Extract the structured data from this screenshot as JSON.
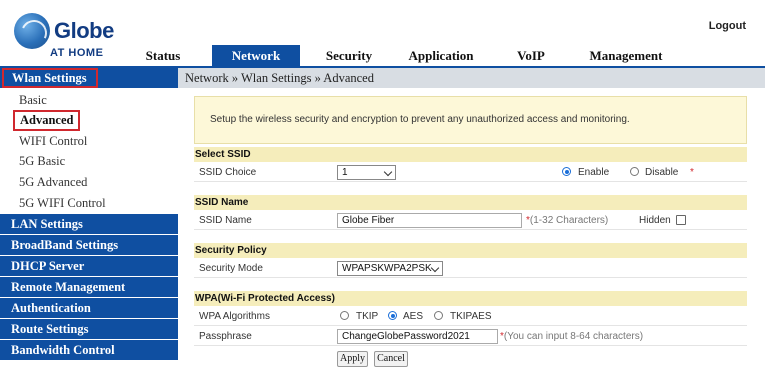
{
  "header": {
    "brand": "Globe",
    "brand_sub": "AT HOME",
    "logout": "Logout"
  },
  "topnav": {
    "tabs": [
      {
        "label": "Status"
      },
      {
        "label": "Network"
      },
      {
        "label": "Security"
      },
      {
        "label": "Application"
      },
      {
        "label": "VoIP"
      },
      {
        "label": "Management"
      }
    ],
    "active": "Network"
  },
  "sidebar": {
    "wlan": "Wlan Settings",
    "wlan_items": [
      "Basic",
      "Advanced",
      "WIFI Control",
      "5G Basic",
      "5G Advanced",
      "5G WIFI Control"
    ],
    "selected": "Advanced",
    "sections": [
      "LAN Settings",
      "BroadBand Settings",
      "DHCP Server",
      "Remote Management",
      "Authentication",
      "Route Settings",
      "Bandwidth Control"
    ]
  },
  "breadcrumb": "Network » Wlan Settings » Advanced",
  "info": "Setup the wireless security and encryption to prevent any unauthorized access and monitoring.",
  "select_ssid": {
    "title": "Select SSID",
    "label": "SSID Choice",
    "value": "1",
    "enable": "Enable",
    "disable": "Disable",
    "state": "Enable",
    "required": "*"
  },
  "ssid_name": {
    "title": "SSID Name",
    "label": "SSID Name",
    "value": "Globe Fiber",
    "hint": "(1-32 Characters)",
    "required": "*",
    "hidden_label": "Hidden",
    "hidden_checked": false
  },
  "security_policy": {
    "title": "Security Policy",
    "label": "Security Mode",
    "value": "WPAPSKWPA2PSK"
  },
  "wpa": {
    "title": "WPA(Wi-Fi Protected Access)",
    "alg_label": "WPA Algorithms",
    "options": [
      "TKIP",
      "AES",
      "TKIPAES"
    ],
    "selected": "AES",
    "pass_label": "Passphrase",
    "pass_value": "ChangeGlobePassword2021",
    "pass_hint": "(You can input 8-64 characters)",
    "required": "*"
  },
  "buttons": {
    "apply": "Apply",
    "cancel": "Cancel"
  },
  "colors": {
    "nav_blue": "#0f4fa1",
    "section_yellow": "#f5edbb",
    "highlight_red": "#d0282e"
  }
}
